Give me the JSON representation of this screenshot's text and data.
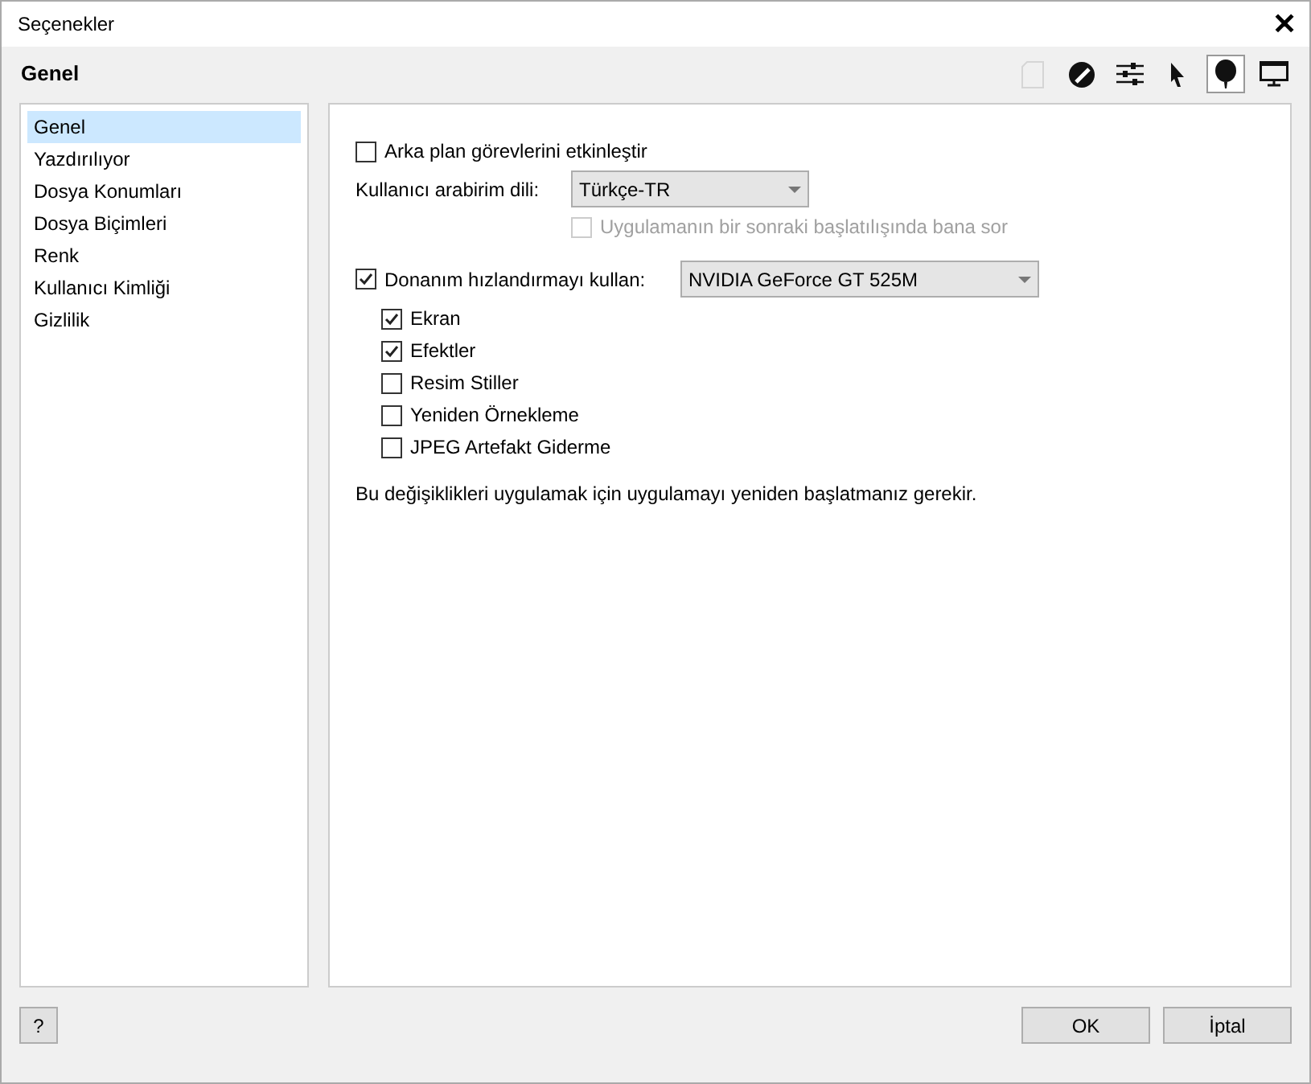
{
  "window": {
    "title": "Seçenekler",
    "close": "✕"
  },
  "header": {
    "title": "Genel"
  },
  "toolbar": [
    {
      "selected": false,
      "disabled": true
    },
    {
      "selected": false,
      "disabled": false
    },
    {
      "selected": false,
      "disabled": false
    },
    {
      "selected": false,
      "disabled": false
    },
    {
      "selected": true,
      "disabled": false
    },
    {
      "selected": false,
      "disabled": false
    }
  ],
  "sidebar": {
    "items": [
      {
        "label": "Genel",
        "selected": true
      },
      {
        "label": "Yazdırılıyor",
        "selected": false
      },
      {
        "label": "Dosya Konumları",
        "selected": false
      },
      {
        "label": "Dosya Biçimleri",
        "selected": false
      },
      {
        "label": "Renk",
        "selected": false
      },
      {
        "label": "Kullanıcı Kimliği",
        "selected": false
      },
      {
        "label": "Gizlilik",
        "selected": false
      }
    ]
  },
  "background_tasks": {
    "label": "Arka plan görevlerini etkinleştir",
    "checked": false,
    "disabled": false
  },
  "ui_language": {
    "label": "Kullanıcı arabirim dili:",
    "value": "Türkçe-TR"
  },
  "ask_next_start": {
    "label": "Uygulamanın bir sonraki başlatılışında bana sor",
    "checked": false,
    "disabled": true
  },
  "hardware_acceleration": {
    "label": "Donanım hızlandırmayı kullan:",
    "checked": true,
    "disabled": false,
    "device": "NVIDIA GeForce GT 525M",
    "children": [
      {
        "label": "Ekran",
        "checked": true,
        "disabled": false
      },
      {
        "label": "Efektler",
        "checked": true,
        "disabled": false
      },
      {
        "label": "Resim Stiller",
        "checked": false,
        "disabled": false
      },
      {
        "label": "Yeniden Örnekleme",
        "checked": false,
        "disabled": false
      },
      {
        "label": "JPEG Artefakt Giderme",
        "checked": false,
        "disabled": false
      }
    ]
  },
  "note": "Bu değişiklikleri uygulamak için uygulamayı yeniden başlatmanız gerekir.",
  "footer": {
    "help": "?",
    "buttons": [
      "OK",
      "İptal"
    ]
  }
}
